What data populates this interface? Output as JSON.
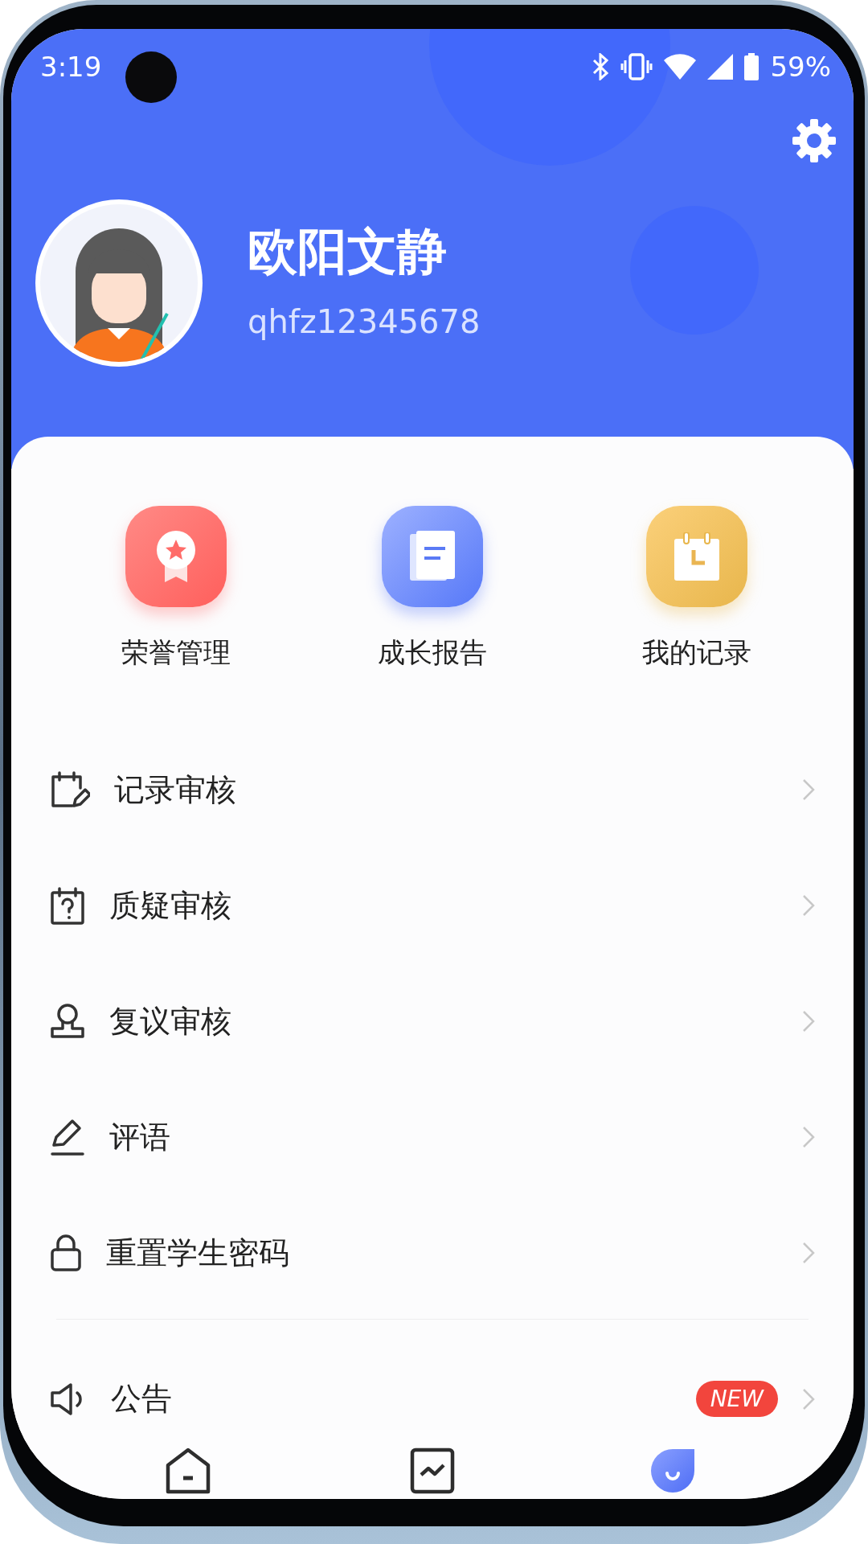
{
  "status_bar": {
    "time": "3:19",
    "battery": "59%"
  },
  "profile": {
    "name": "欧阳文静",
    "account": "qhfz12345678"
  },
  "quick_actions": [
    {
      "label": "荣誉管理",
      "kind": "honor"
    },
    {
      "label": "成长报告",
      "kind": "report"
    },
    {
      "label": "我的记录",
      "kind": "record"
    }
  ],
  "menu": [
    {
      "label": "记录审核",
      "kind": "record-review"
    },
    {
      "label": "质疑审核",
      "kind": "question-review"
    },
    {
      "label": "复议审核",
      "kind": "reconsider-review"
    },
    {
      "label": "评语",
      "kind": "comment"
    },
    {
      "label": "重置学生密码",
      "kind": "password"
    }
  ],
  "notices": [
    {
      "label": "公告",
      "kind": "notice",
      "badge": "NEW"
    }
  ],
  "bottom_nav": [
    {
      "kind": "home",
      "selected": false
    },
    {
      "kind": "chart",
      "selected": false
    },
    {
      "kind": "profile",
      "selected": true
    }
  ]
}
